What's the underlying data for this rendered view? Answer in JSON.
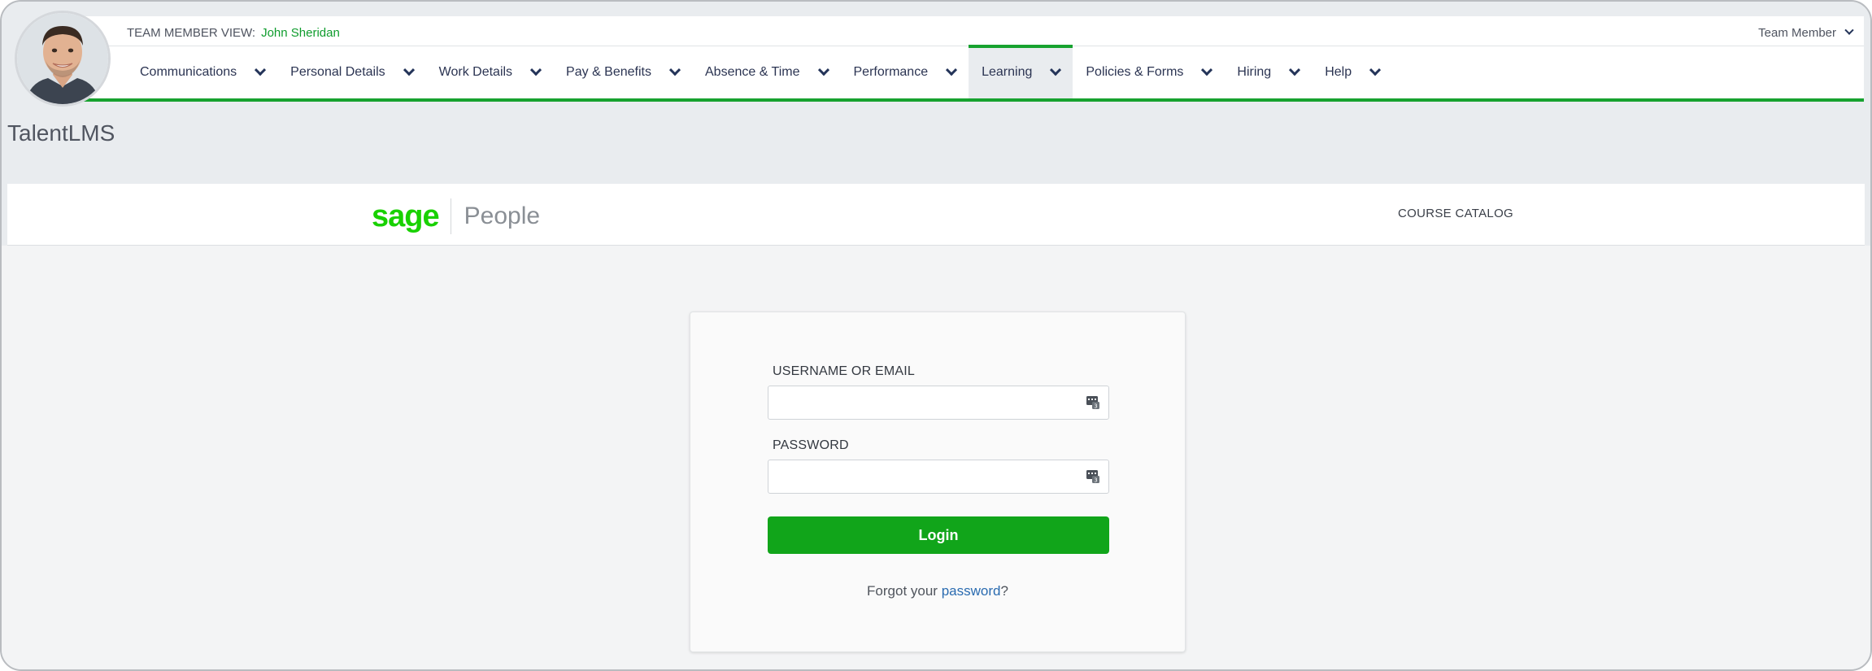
{
  "header": {
    "member_view_label": "TEAM MEMBER VIEW:",
    "member_name": "John Sheridan",
    "role_menu_label": "Team Member"
  },
  "nav": {
    "items": [
      {
        "label": "Communications"
      },
      {
        "label": "Personal Details"
      },
      {
        "label": "Work Details"
      },
      {
        "label": "Pay & Benefits"
      },
      {
        "label": "Absence & Time"
      },
      {
        "label": "Performance"
      },
      {
        "label": "Learning",
        "active": true
      },
      {
        "label": "Policies & Forms"
      },
      {
        "label": "Hiring"
      },
      {
        "label": "Help"
      }
    ]
  },
  "page": {
    "title": "TalentLMS"
  },
  "lms": {
    "logo_primary": "sage",
    "logo_secondary": "People",
    "catalog_link": "COURSE CATALOG"
  },
  "login": {
    "username_label": "USERNAME OR EMAIL",
    "username_value": "",
    "password_label": "PASSWORD",
    "password_value": "",
    "button_label": "Login",
    "forgot_prefix": "Forgot your ",
    "forgot_link": "password",
    "forgot_suffix": "?"
  },
  "colors": {
    "brand_green": "#19d100",
    "nav_green": "#17a22f",
    "button_green": "#11a51a",
    "link_blue": "#2a6bb0",
    "member_name_green": "#0f9c2d"
  }
}
